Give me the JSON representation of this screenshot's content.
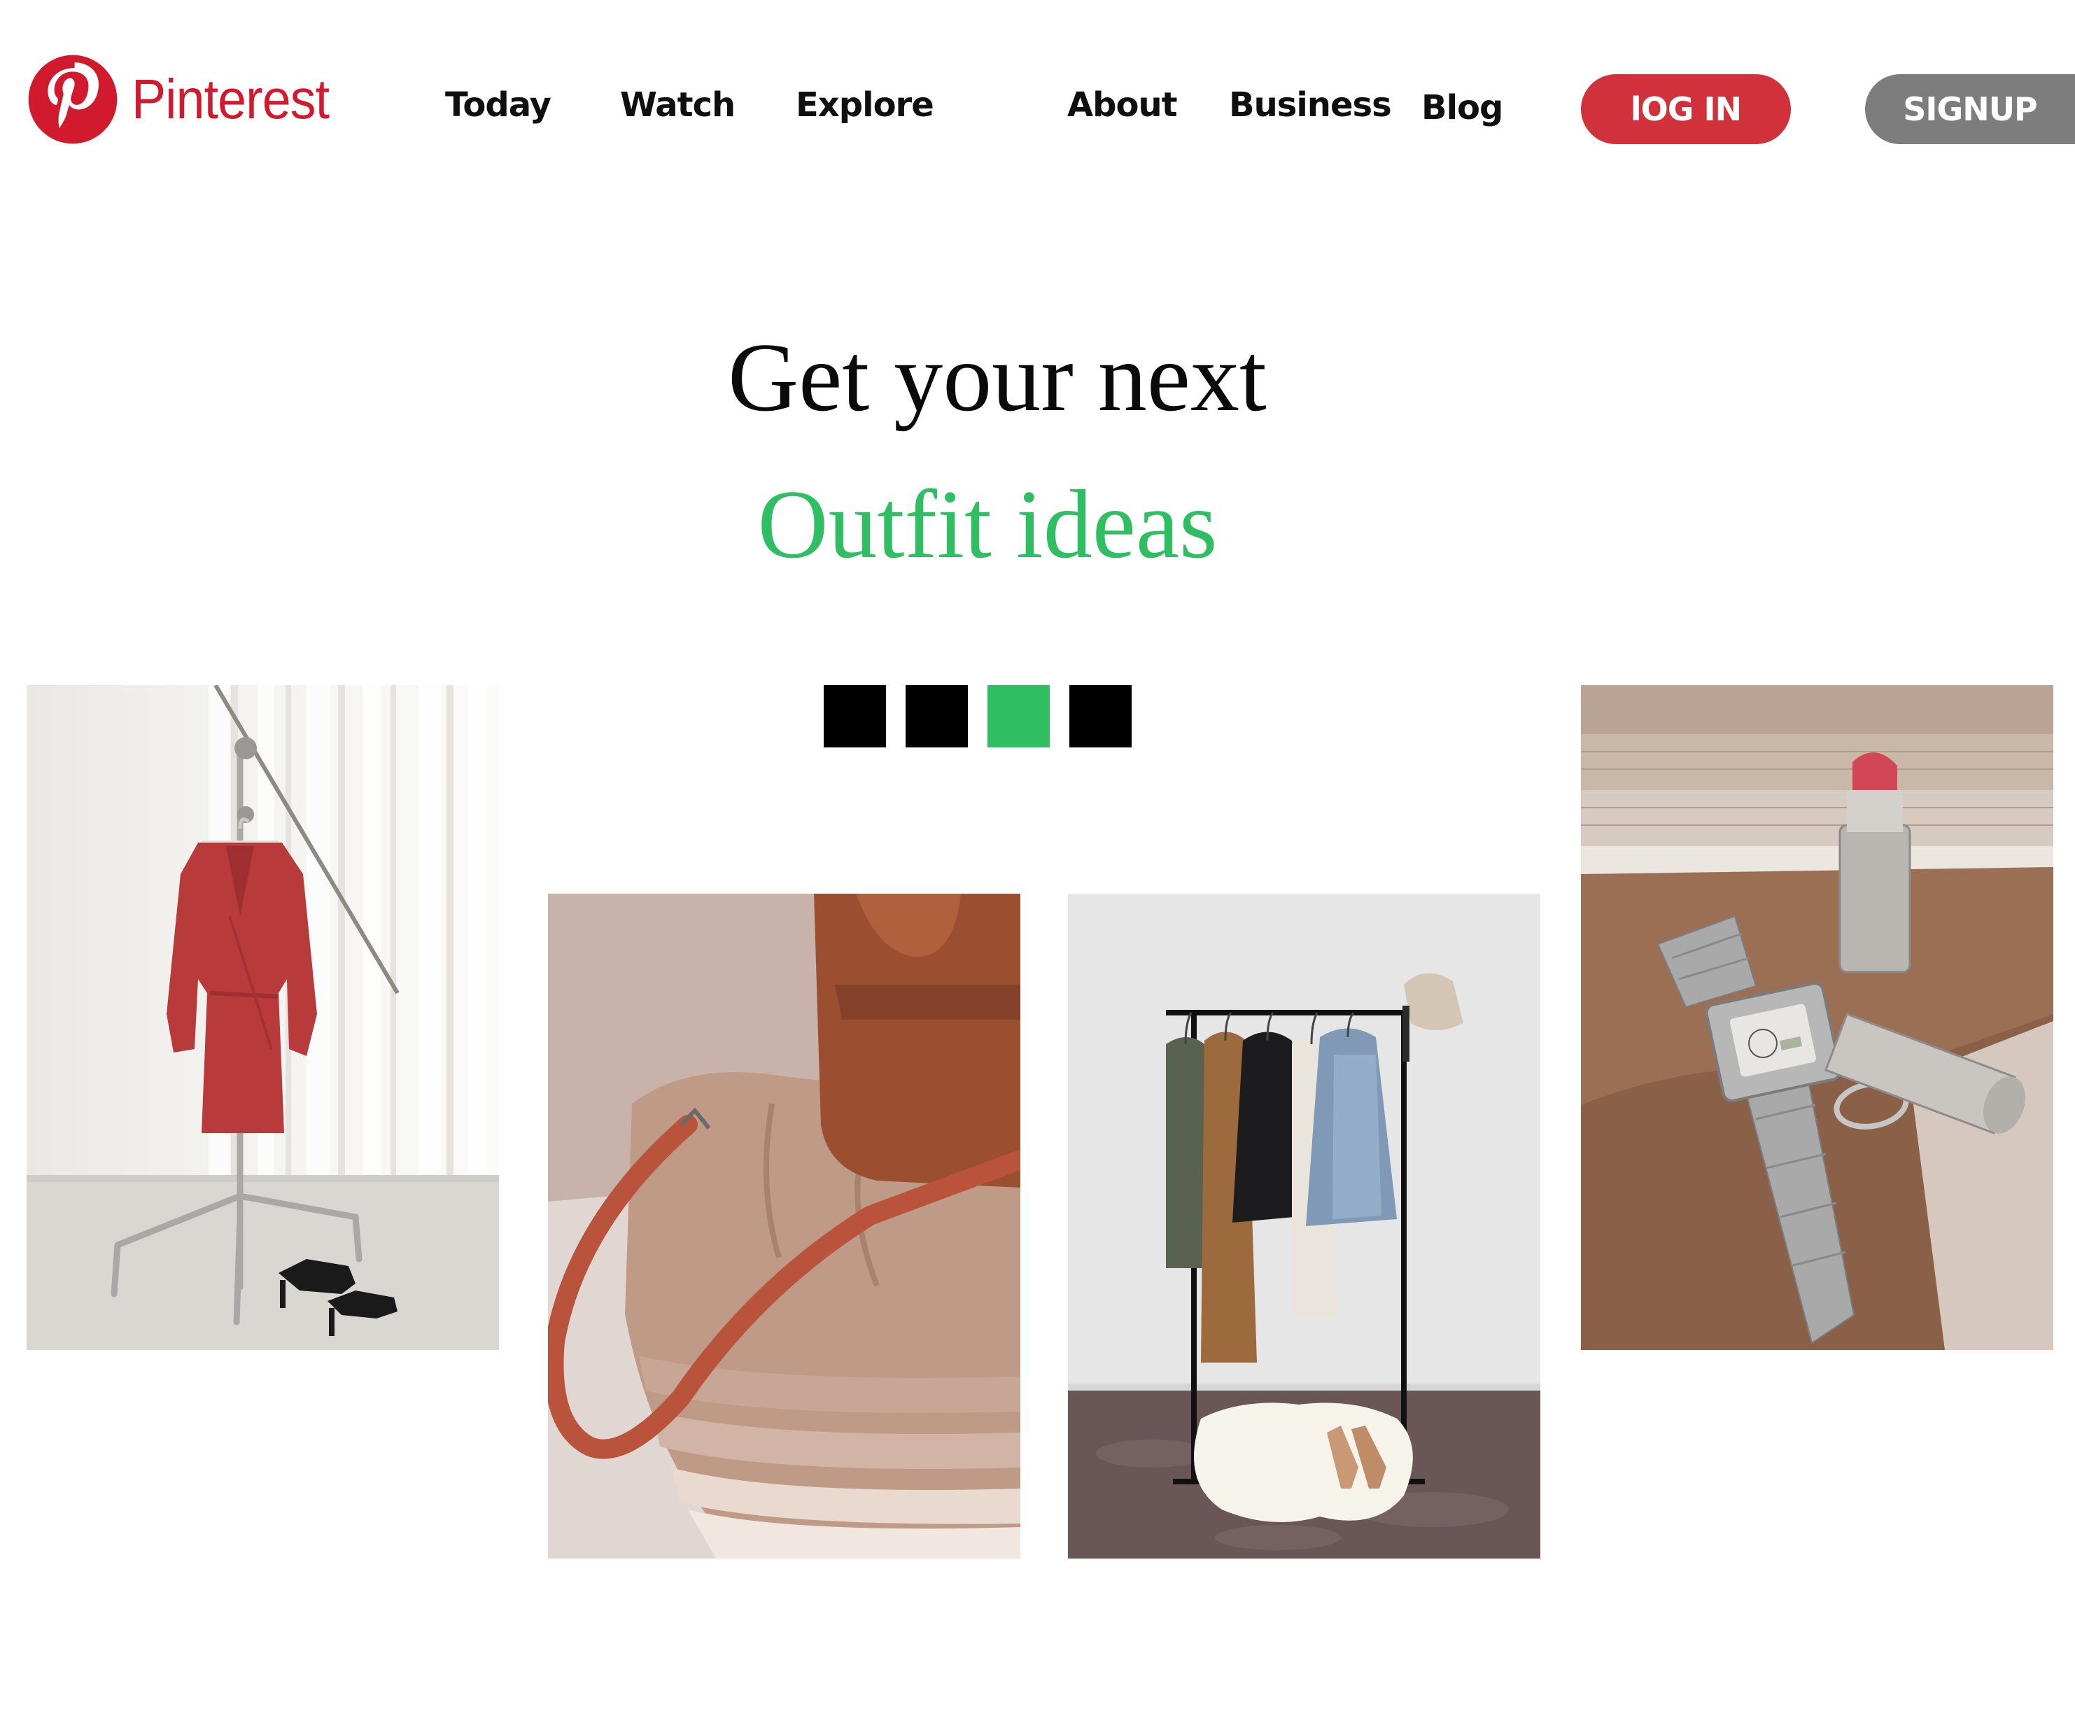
{
  "brand": {
    "name": "Pinterest",
    "color": "#d21a2e"
  },
  "nav": {
    "items": [
      "Today",
      "Watch",
      "Explore",
      "About",
      "Business",
      "Blog"
    ]
  },
  "auth": {
    "login_label": "lOG IN",
    "login_color": "#d1313b",
    "signup_label": "SIGNUP",
    "signup_color": "#7d7d7d"
  },
  "hero": {
    "line1": "Get your next",
    "line2": "Outfit ideas",
    "accent_color": "#2fbf62"
  },
  "carousel": {
    "dot_count": 4,
    "active_index": 2
  },
  "photos": [
    {
      "icon": "red-dress-on-stand-image"
    },
    {
      "icon": "brown-leather-bag-on-folded-clothes-image"
    },
    {
      "icon": "clothing-rack-with-jackets-image"
    },
    {
      "icon": "silver-watch-and-lipstick-image"
    }
  ]
}
